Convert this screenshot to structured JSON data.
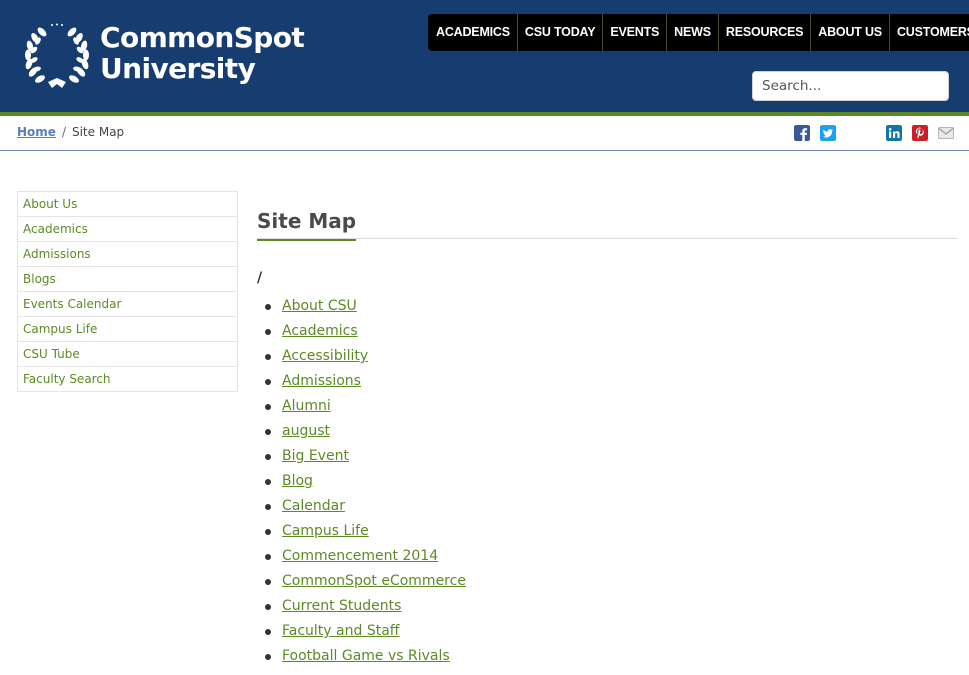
{
  "brand": {
    "line1": "CommonSpot",
    "line2": "University",
    "colors": {
      "header": "#173c70",
      "accent": "#5d8a25",
      "nav": "#000000"
    }
  },
  "top_nav": [
    "ACADEMICS",
    "CSU TODAY",
    "EVENTS",
    "NEWS",
    "RESOURCES",
    "ABOUT US",
    "CUSTOMERS"
  ],
  "search": {
    "placeholder": "Search..."
  },
  "breadcrumb": {
    "home": "Home",
    "separator": "/",
    "current": "Site Map"
  },
  "share_icons": [
    "facebook-icon",
    "twitter-icon",
    "linkedin-icon",
    "pinterest-icon",
    "email-icon"
  ],
  "sidebar": {
    "items": [
      "About Us",
      "Academics",
      "Admissions",
      "Blogs",
      "Events Calendar",
      "Campus Life",
      "CSU Tube",
      "Faculty Search"
    ]
  },
  "main": {
    "title": "Site Map",
    "root": "/",
    "links": [
      "About CSU",
      "Academics",
      "Accessibility",
      "Admissions",
      "Alumni",
      "august",
      "Big Event",
      "Blog",
      "Calendar",
      "Campus Life",
      "Commencement 2014",
      "CommonSpot eCommerce",
      "Current Students",
      "Faculty and Staff",
      "Football Game vs Rivals"
    ]
  }
}
